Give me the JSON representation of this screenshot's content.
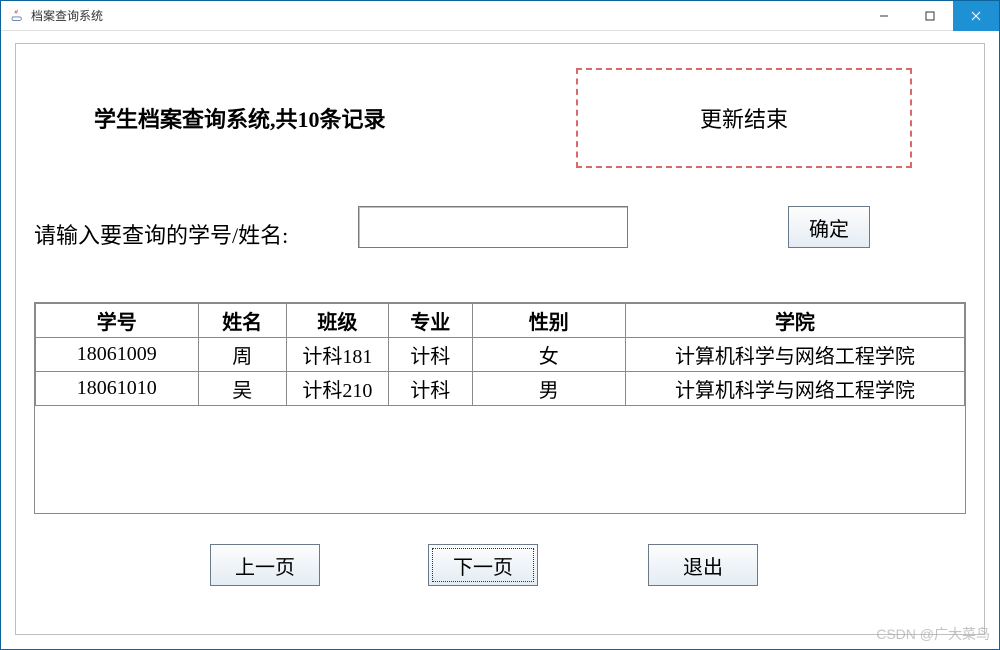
{
  "window": {
    "title": "档案查询系统"
  },
  "header": {
    "title": "学生档案查询系统,共10条记录",
    "status": "更新结束"
  },
  "query": {
    "label": "请输入要查询的学号/姓名:",
    "value": "",
    "confirm": "确定"
  },
  "table": {
    "headers": {
      "id": "学号",
      "name": "姓名",
      "class": "班级",
      "major": "专业",
      "sex": "性别",
      "college": "学院"
    },
    "rows": [
      {
        "id": "18061009",
        "name": "周",
        "class": "计科181",
        "major": "计科",
        "sex": "女",
        "college": "计算机科学与网络工程学院"
      },
      {
        "id": "18061010",
        "name": "吴",
        "class": "计科210",
        "major": "计科",
        "sex": "男",
        "college": "计算机科学与网络工程学院"
      }
    ]
  },
  "footer": {
    "prev": "上一页",
    "next": "下一页",
    "exit": "退出"
  },
  "watermark": "CSDN @广大菜鸟"
}
